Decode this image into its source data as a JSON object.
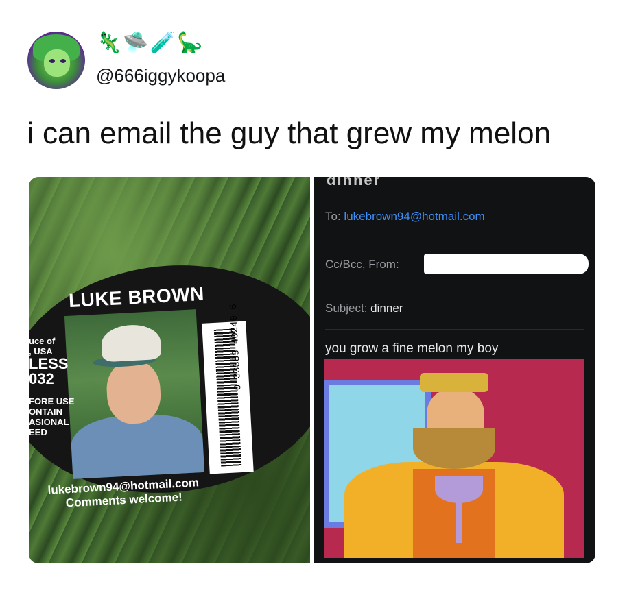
{
  "tweet": {
    "handle": "@666iggykoopa",
    "emoji": [
      "🦎",
      "🛸",
      "🧪",
      "🦕"
    ],
    "text": "i can email the guy that grew my melon"
  },
  "left_photo": {
    "sticker_name": "LUKE BROWN",
    "barcode_number": "0 33383 40240 6",
    "side_text": [
      "uce of",
      ", USA",
      "LESS",
      "032",
      "FORE USE",
      "ONTAIN",
      "ASIONAL",
      "EED"
    ],
    "email_line": "lukebrown94@hotmail.com",
    "comments_line": "Comments welcome!"
  },
  "right_photo": {
    "cut_header": "dinner",
    "to_label": "To:",
    "to_address": "lukebrown94@hotmail.com",
    "cc_label": "Cc/Bcc, From:",
    "subject_label": "Subject:",
    "subject_value": "dinner",
    "body_text": "you grow a fine melon my boy"
  }
}
